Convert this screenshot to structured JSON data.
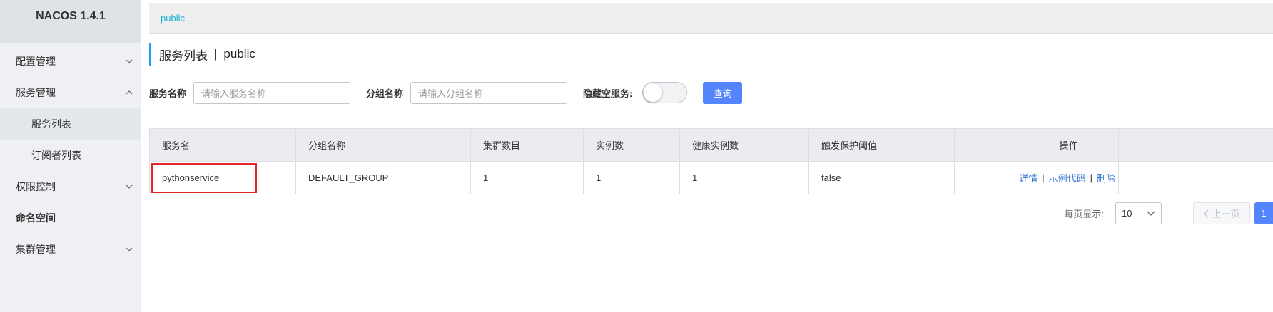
{
  "app": {
    "title": "NACOS 1.4.1"
  },
  "sidebar": {
    "items": [
      {
        "label": "配置管理",
        "expanded": false
      },
      {
        "label": "服务管理",
        "expanded": true
      },
      {
        "label": "服务列表",
        "active": true
      },
      {
        "label": "订阅者列表"
      },
      {
        "label": "权限控制",
        "expanded": false
      },
      {
        "label": "命名空间"
      },
      {
        "label": "集群管理",
        "expanded": false
      }
    ]
  },
  "breadcrumb": {
    "namespace": "public"
  },
  "page": {
    "title": "服务列表",
    "separator": "|",
    "namespace": "public"
  },
  "filters": {
    "service_name_label": "服务名称",
    "service_name_placeholder": "请输入服务名称",
    "group_name_label": "分组名称",
    "group_name_placeholder": "请输入分组名称",
    "hide_empty_label": "隐藏空服务:",
    "hide_empty_on": false,
    "query_button": "查询"
  },
  "table": {
    "headers": [
      "服务名",
      "分组名称",
      "集群数目",
      "实例数",
      "健康实例数",
      "触发保护阈值",
      "操作"
    ],
    "rows": [
      {
        "service": "pythonservice",
        "group": "DEFAULT_GROUP",
        "clusters": "1",
        "instances": "1",
        "healthy": "1",
        "threshold": "false",
        "actions": [
          "详情",
          "示例代码",
          "删除"
        ]
      }
    ]
  },
  "pagination": {
    "per_page_label": "每页显示:",
    "per_page_value": "10",
    "prev_label": "上一页",
    "current_page": "1"
  },
  "colors": {
    "accent": "#5584ff",
    "breadcrumb": "#20b2d6",
    "highlight": "#e3242b",
    "link": "#2a70d4"
  }
}
